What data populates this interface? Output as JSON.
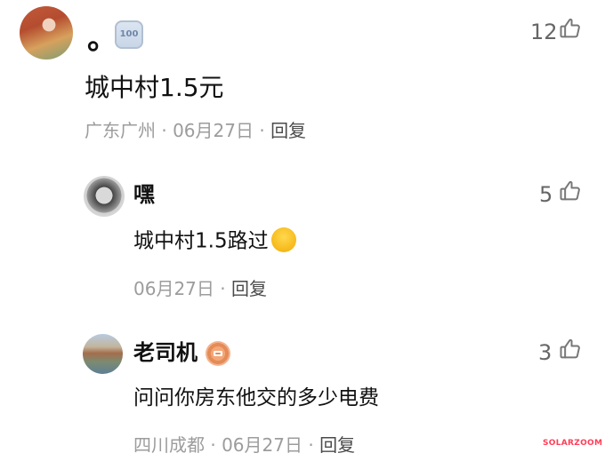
{
  "comments": [
    {
      "username": "。",
      "badge": "100",
      "text": "城中村1.5元",
      "location": "广东广州",
      "date": "06月27日",
      "reply_label": "回复",
      "likes": "12"
    },
    {
      "username": "嘿",
      "text": "城中村1.5路过",
      "date": "06月27日",
      "reply_label": "回复",
      "likes": "5"
    },
    {
      "username": "老司机",
      "text": "问问你房东他交的多少电费",
      "location": "四川成都",
      "date": "06月27日",
      "reply_label": "回复",
      "likes": "3"
    }
  ],
  "watermark": "SOLARZOOM"
}
